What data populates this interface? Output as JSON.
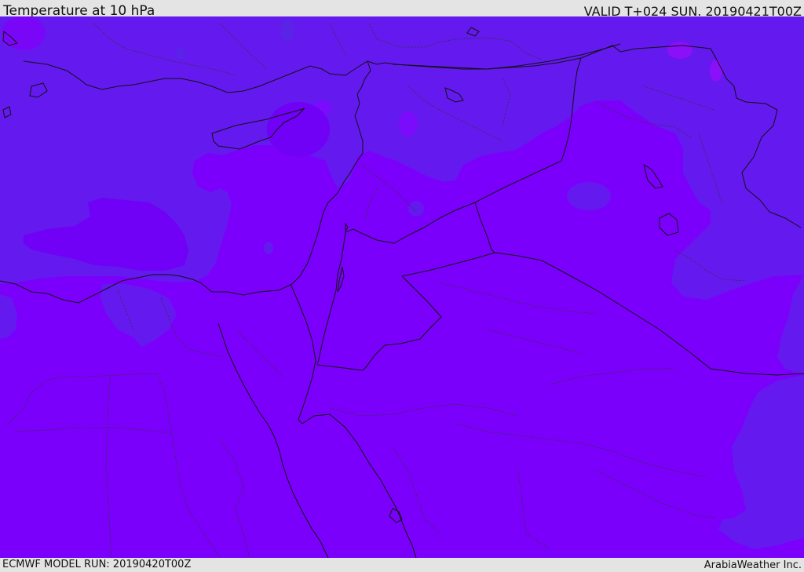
{
  "header": {
    "title": "Temperature at 10 hPa",
    "valid_time": "VALID T+024 SUN. 20190421T00Z"
  },
  "footer": {
    "model_run": "ECMWF MODEL RUN: 20190420T00Z",
    "provider": "ArabiaWeather Inc."
  },
  "map": {
    "colors": {
      "field_primary": "#7b00fb",
      "field_cool": "#6419ef",
      "field_warm_spot": "#8c0ffa",
      "coastline": "#111111",
      "border": "#222222"
    }
  }
}
